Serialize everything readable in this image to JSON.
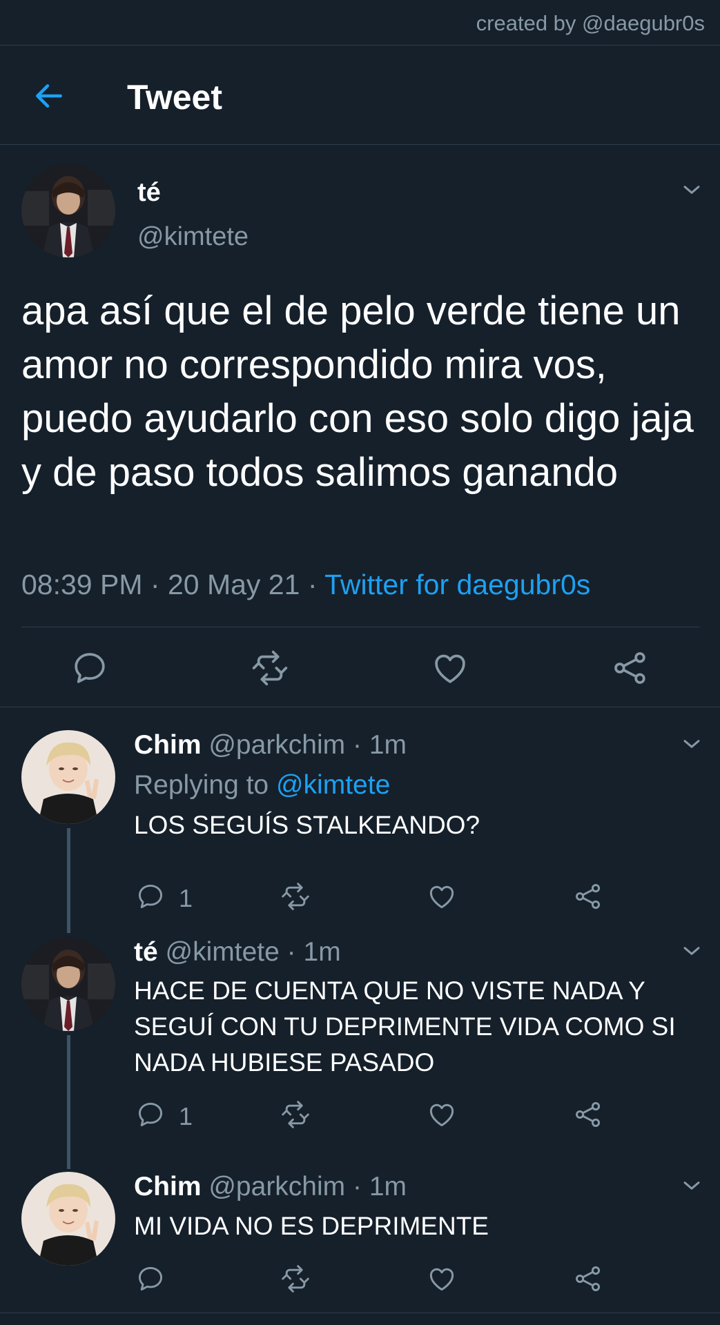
{
  "credit": "created by @daegubr0s",
  "header": {
    "title": "Tweet",
    "back_icon": "arrow-left-icon"
  },
  "colors": {
    "background": "#15202b",
    "accent": "#1da1f2",
    "muted": "#8899a6",
    "border": "#2f3d4c"
  },
  "main_tweet": {
    "name": "té",
    "handle": "@kimtete",
    "text": "apa así que el de pelo verde tiene un amor no correspondido mira vos, puedo ayudarlo con eso solo digo jaja y de paso todos salimos ganando",
    "time": "08:39 PM",
    "date": "20 May 21",
    "sep": "·",
    "source": "Twitter for daegubr0s",
    "actions": [
      "reply-icon",
      "retweet-icon",
      "like-icon",
      "share-icon"
    ]
  },
  "replies": [
    {
      "name": "Chim",
      "handle": "@parkchim",
      "time": "1m",
      "replying_label": "Replying to",
      "replying_to": "@kimtete",
      "text": "LOS SEGUÍS STALKEANDO?",
      "reply_count": "1"
    },
    {
      "name": "té",
      "handle": "@kimtete",
      "time": "1m",
      "text": "HACE DE CUENTA QUE NO VISTE NADA Y SEGUÍ CON TU DEPRIMENTE VIDA COMO SI NADA HUBIESE PASADO",
      "reply_count": "1"
    },
    {
      "name": "Chim",
      "handle": "@parkchim",
      "time": "1m",
      "text": "MI VIDA NO ES DEPRIMENTE",
      "reply_count": ""
    }
  ]
}
